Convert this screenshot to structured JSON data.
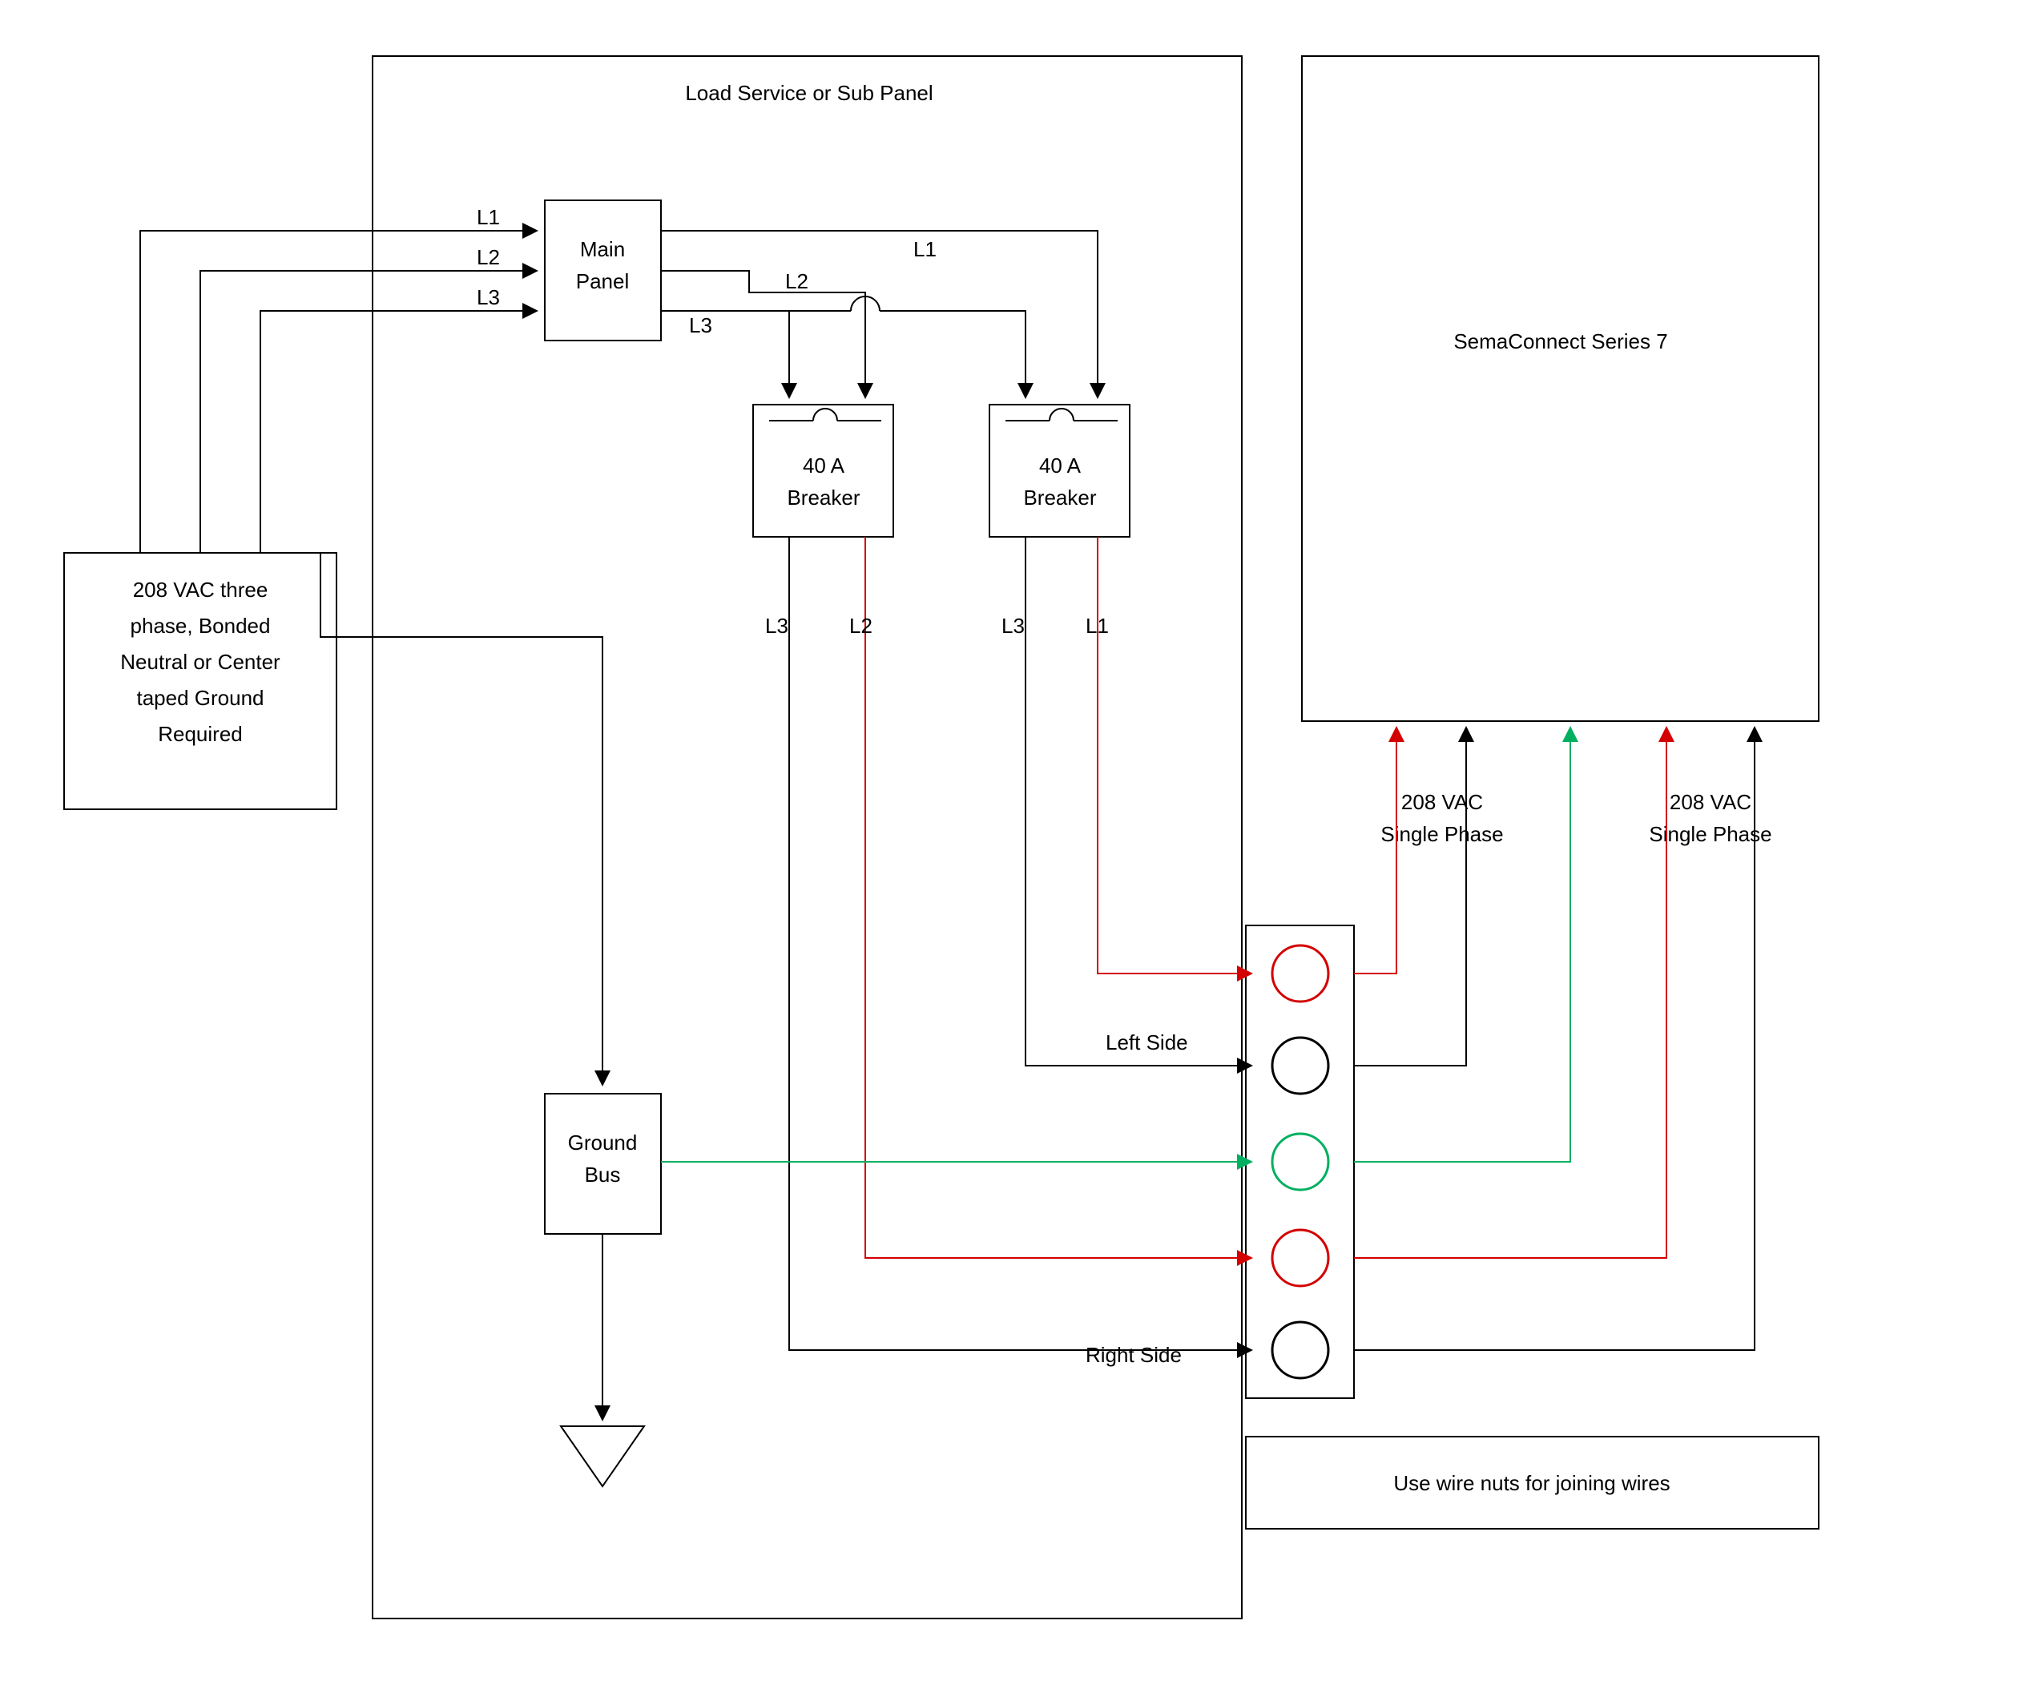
{
  "panel": {
    "title": "Load Service or Sub Panel"
  },
  "source": {
    "line1": "208 VAC three",
    "line2": "phase, Bonded",
    "line3": "Neutral or Center",
    "line4": "taped Ground",
    "line5": "Required"
  },
  "main": {
    "line1": "Main",
    "line2": "Panel"
  },
  "breakerA": {
    "line1": "40 A",
    "line2": "Breaker"
  },
  "breakerB": {
    "line1": "40 A",
    "line2": "Breaker"
  },
  "ground": {
    "line1": "Ground",
    "line2": "Bus"
  },
  "device": {
    "title": "SemaConnect Series 7"
  },
  "notes": {
    "left": "Left Side",
    "right": "Right Side",
    "wirenuts": "Use wire nuts for joining wires",
    "phase1": "208 VAC",
    "phase1b": "Single Phase",
    "phase2": "208 VAC",
    "phase2b": "Single Phase"
  },
  "labels": {
    "L1": "L1",
    "L2": "L2",
    "L3": "L3",
    "bA_L3": "L3",
    "bA_L2": "L2",
    "bB_L3": "L3",
    "bB_L1": "L1"
  },
  "colors": {
    "black": "#000000",
    "red": "#d40000",
    "green": "#00b060"
  }
}
